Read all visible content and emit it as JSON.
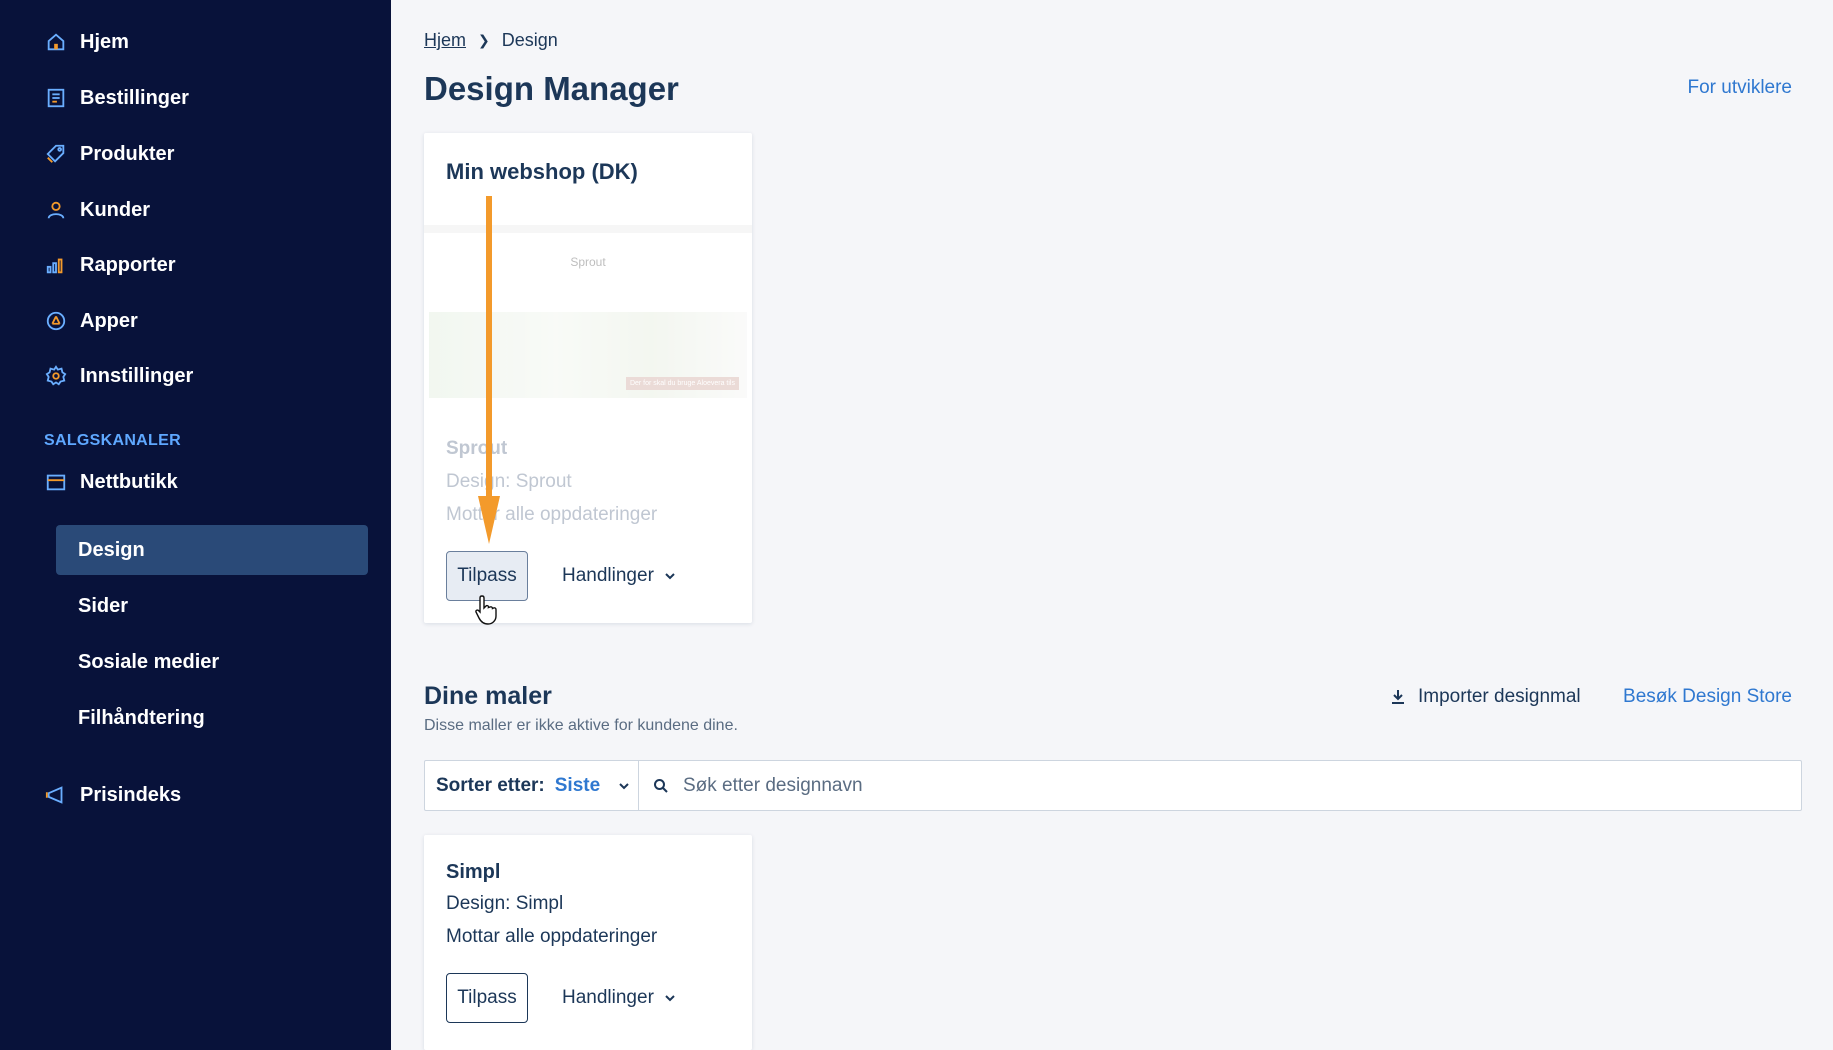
{
  "sidebar": {
    "items": [
      {
        "label": "Hjem",
        "icon": "home-icon"
      },
      {
        "label": "Bestillinger",
        "icon": "orders-icon"
      },
      {
        "label": "Produkter",
        "icon": "tag-icon"
      },
      {
        "label": "Kunder",
        "icon": "user-icon"
      },
      {
        "label": "Rapporter",
        "icon": "chart-icon"
      },
      {
        "label": "Apper",
        "icon": "apps-icon"
      },
      {
        "label": "Innstillinger",
        "icon": "gear-icon"
      }
    ],
    "section_label": "SALGSKANALER",
    "channel": {
      "label": "Nettbutikk",
      "icon": "store-icon"
    },
    "sub_items": [
      {
        "label": "Design",
        "active": true
      },
      {
        "label": "Sider"
      },
      {
        "label": "Sosiale medier"
      },
      {
        "label": "Filhåndtering"
      }
    ],
    "bottom": {
      "label": "Prisindeks",
      "icon": "megaphone-icon"
    }
  },
  "breadcrumb": {
    "home": "Hjem",
    "current": "Design"
  },
  "page_title": "Design Manager",
  "dev_link": "For utviklere",
  "active_shop": {
    "title": "Min webshop (DK)",
    "preview_brand": "Sprout",
    "preview_badge": "Der for skal du bruge Aloevera tils",
    "theme_name": "Sprout",
    "design_line": "Design: Sprout",
    "updates_line": "Mottar alle oppdateringer",
    "customize_label": "Tilpass",
    "actions_label": "Handlinger"
  },
  "templates": {
    "title": "Dine maler",
    "subtitle": "Disse maller er ikke aktive for kundene dine.",
    "import_label": "Importer designmal",
    "store_link": "Besøk Design Store",
    "sort_label": "Sorter etter:",
    "sort_value": "Siste",
    "search_placeholder": "Søk etter designnavn",
    "items": [
      {
        "name": "Simpl",
        "design_line": "Design: Simpl",
        "updates_line": "Mottar alle oppdateringer",
        "customize_label": "Tilpass",
        "actions_label": "Handlinger"
      }
    ]
  },
  "colors": {
    "sidebar_bg": "#08123a",
    "active_item": "#2a4a78",
    "accent_blue": "#2f78d0",
    "icon_orange": "#f39a2b",
    "arrow": "#f39a2b",
    "text_dark": "#1c3758"
  }
}
